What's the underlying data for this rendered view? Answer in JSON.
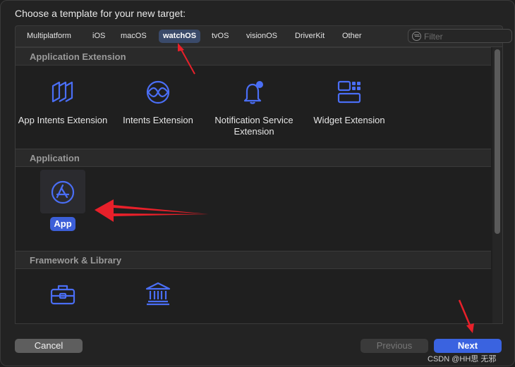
{
  "dialog": {
    "title": "Choose a template for your new target:"
  },
  "tabs": [
    {
      "label": "Multiplatform",
      "selected": false
    },
    {
      "label": "iOS",
      "selected": false
    },
    {
      "label": "macOS",
      "selected": false
    },
    {
      "label": "watchOS",
      "selected": true
    },
    {
      "label": "tvOS",
      "selected": false
    },
    {
      "label": "visionOS",
      "selected": false
    },
    {
      "label": "DriverKit",
      "selected": false
    },
    {
      "label": "Other",
      "selected": false
    }
  ],
  "filter": {
    "placeholder": "Filter",
    "value": ""
  },
  "sections": [
    {
      "title": "Application Extension",
      "items": [
        {
          "label": "App Intents Extension",
          "icon": "app-intents-icon"
        },
        {
          "label": "Intents Extension",
          "icon": "intents-icon"
        },
        {
          "label": "Notification Service Extension",
          "icon": "notification-bell-icon"
        },
        {
          "label": "Widget Extension",
          "icon": "widget-icon"
        }
      ]
    },
    {
      "title": "Application",
      "items": [
        {
          "label": "App",
          "icon": "app-store-icon",
          "selected": true
        }
      ]
    },
    {
      "title": "Framework & Library",
      "items": [
        {
          "icon": "toolbox-icon"
        },
        {
          "icon": "library-building-icon"
        }
      ]
    }
  ],
  "buttons": {
    "cancel": "Cancel",
    "previous": "Previous",
    "next": "Next"
  },
  "watermark": "CSDN @HH思 无邪",
  "colors": {
    "accent": "#3c5fd8",
    "icon_blue": "#4a6ef5",
    "annotation_red": "#e8202a"
  }
}
